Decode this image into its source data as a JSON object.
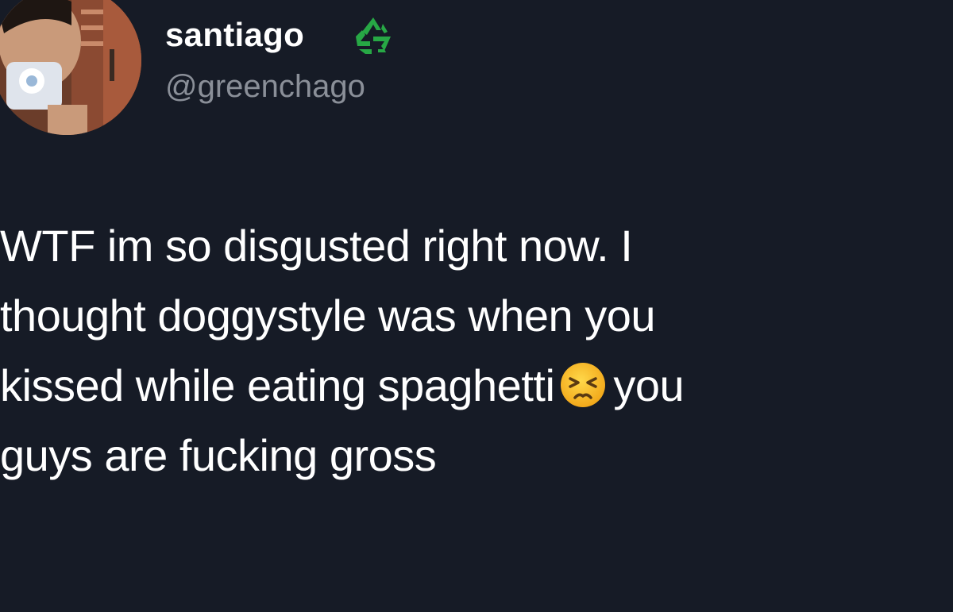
{
  "author": {
    "display_name": "santiago",
    "handle": "@greenchago",
    "badge_icon": "recycling-symbol",
    "badge_color": "#27a845",
    "avatar_icon": "profile-photo"
  },
  "tweet": {
    "lines": [
      "WTF im so disgusted right now. I",
      "thought doggystyle was when you",
      "kissed while eating spaghetti",
      "you",
      "guys are fucking gross"
    ],
    "emoji_icon": "persevering-face"
  },
  "colors": {
    "background": "#161b26",
    "text": "#ffffff",
    "handle": "#8a8f98"
  }
}
